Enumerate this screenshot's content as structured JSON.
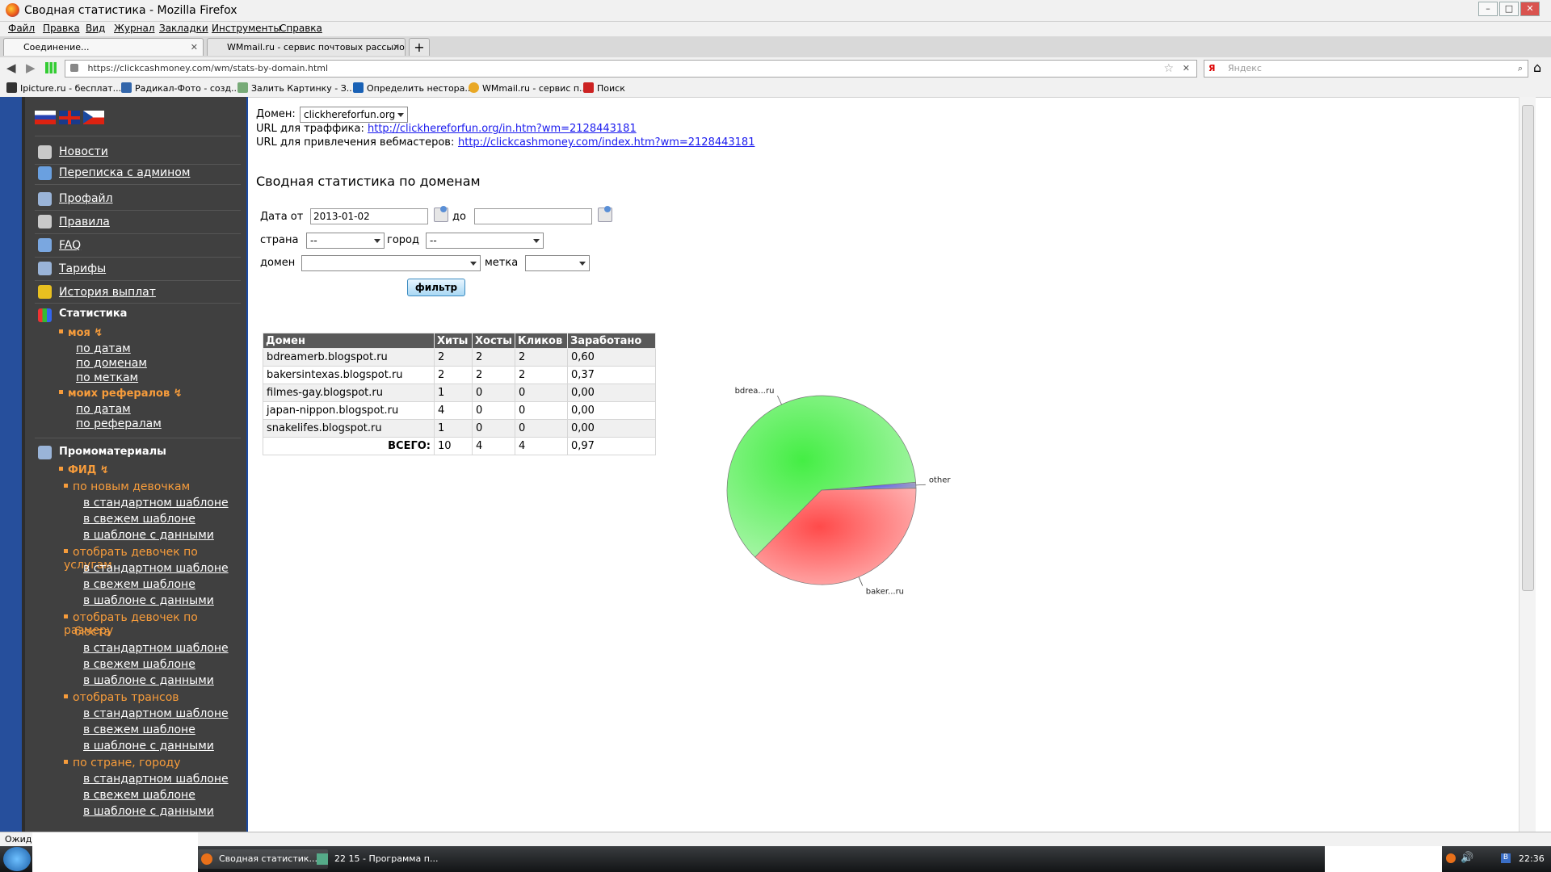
{
  "window": {
    "title": "Сводная статистика - Mozilla Firefox"
  },
  "menu": [
    "Файл",
    "Правка",
    "Вид",
    "Журнал",
    "Закладки",
    "Инструменты",
    "Справка"
  ],
  "tabs": [
    {
      "label": "Соединение...",
      "active": true
    },
    {
      "label": "WMmail.ru - сервис почтовых рассылок...",
      "active": false
    }
  ],
  "address": {
    "url": "https://clickcashmoney.com/wm/stats-by-domain.html",
    "search_placeholder": "Яндекс"
  },
  "bookmarks": [
    "Ipicture.ru - бесплат...",
    "Радикал-Фото - созд...",
    "Залить Картинку - З...",
    "Определить несторa...",
    "WMmail.ru - сервис п...",
    "Поиск"
  ],
  "sidebar": {
    "nav": [
      "Новости",
      "Переписка с админом",
      "Профайл",
      "Правила",
      "FAQ",
      "Тарифы",
      "История выплат"
    ],
    "stats_title": "Статистика",
    "my": "моя",
    "my_links": [
      "по датам",
      "по доменам",
      "по меткам"
    ],
    "refs": "моих рефералов",
    "refs_links": [
      "по датам",
      "по рефералам"
    ],
    "promo_title": "Промоматериалы",
    "feed": "ФИД",
    "groups": [
      {
        "title": "по новым девочкам",
        "links": [
          "в стандартном шаблоне",
          "в свежем шаблоне",
          "в шаблоне с данными"
        ]
      },
      {
        "title": "отобрать девочек по услугам",
        "links": [
          "в стандартном шаблоне",
          "в свежем шаблоне",
          "в шаблоне с данными"
        ]
      },
      {
        "title": "отобрать девочек по размеру",
        "title2": "бюста",
        "links": [
          "в стандартном шаблоне",
          "в свежем шаблоне",
          "в шаблоне с данными"
        ]
      },
      {
        "title": "отобрать трансов",
        "links": [
          "в стандартном шаблоне",
          "в свежем шаблоне",
          "в шаблоне с данными"
        ]
      },
      {
        "title": "по стране, городу",
        "links": [
          "в стандартном шаблоне",
          "в свежем шаблоне",
          "в шаблоне с данными"
        ]
      }
    ]
  },
  "main": {
    "domain_label": "Домен:",
    "domain_value": "clickhereforfun.org",
    "traffic_label": "URL для траффика:",
    "traffic_url": "http://clickhereforfun.org/in.htm?wm=2128443181",
    "webmasters_label": "URL для привлечения вебмастеров:",
    "webmasters_url": "http://clickcashmoney.com/index.htm?wm=2128443181",
    "heading": "Сводная статистика по доменам",
    "filter": {
      "date_from_label": "Дата от",
      "date_from": "2013-01-02",
      "date_to_label": "до",
      "date_to": "",
      "country_label": "страна",
      "country": "--",
      "city_label": "город",
      "city": "--",
      "domain_label": "домен",
      "domain": "",
      "tag_label": "метка",
      "tag": "",
      "button": "фильтр"
    },
    "table": {
      "headers": [
        "Домен",
        "Хиты",
        "Хосты",
        "Кликов",
        "Заработано"
      ],
      "rows": [
        [
          "bdreamerb.blogspot.ru",
          "2",
          "2",
          "2",
          "0,60"
        ],
        [
          "bakersintexas.blogspot.ru",
          "2",
          "2",
          "2",
          "0,37"
        ],
        [
          "filmes-gay.blogspot.ru",
          "1",
          "0",
          "0",
          "0,00"
        ],
        [
          "japan-nippon.blogspot.ru",
          "4",
          "0",
          "0",
          "0,00"
        ],
        [
          "snakelifes.blogspot.ru",
          "1",
          "0",
          "0",
          "0,00"
        ]
      ],
      "total_label": "ВСЕГО:",
      "total": [
        "10",
        "4",
        "4",
        "0,97"
      ]
    }
  },
  "chart_data": {
    "type": "pie",
    "slices": [
      {
        "label": "bdrea...ru",
        "value": 0.6,
        "color": "#44ee44"
      },
      {
        "label": "baker...ru",
        "value": 0.37,
        "color": "#ff4a4a"
      },
      {
        "label": "other",
        "value": 0.01,
        "color": "#4a4aff"
      }
    ]
  },
  "status": {
    "text": "Ожида"
  },
  "taskbar": {
    "items": [
      "Сводная статистик...",
      "22 15 - Программа п..."
    ],
    "clock": "22:36"
  }
}
